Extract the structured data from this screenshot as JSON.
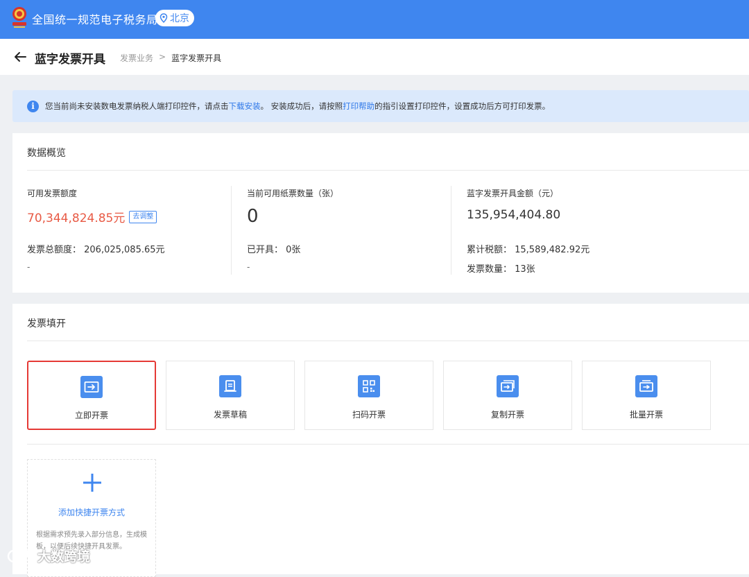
{
  "header": {
    "site_title": "全国统一规范电子税务局",
    "location": "北京"
  },
  "titlebar": {
    "title": "蓝字发票开具",
    "breadcrumb": [
      "发票业务",
      "蓝字发票开具"
    ]
  },
  "notice": {
    "text_1": "您当前尚未安装数电发票纳税人端打印控件，请点击",
    "link_1": "下载安装",
    "text_2": "。 安装成功后，请按照",
    "link_2": "打印帮助",
    "text_3": "的指引设置打印控件，设置成功后方可打印发票。"
  },
  "overview": {
    "title": "数据概览",
    "col1": {
      "label": "可用发票额度",
      "value": "70,344,824.85元",
      "adjust_label": "去调整",
      "total": "发票总额度：  206,025,085.65元",
      "dash": "-"
    },
    "col2": {
      "label": "当前可用纸票数量（张）",
      "value": "0",
      "issued": "已开具：  0张",
      "dash": "-"
    },
    "col3": {
      "label": "蓝字发票开具金额（元）",
      "value": "135,954,404.80",
      "tax": "累计税额：  15,589,482.92元",
      "count": "发票数量：  13张"
    }
  },
  "issue": {
    "title": "发票填开",
    "tiles": [
      {
        "label": "立即开票",
        "icon": "invoice-now-icon"
      },
      {
        "label": "发票草稿",
        "icon": "draft-icon"
      },
      {
        "label": "扫码开票",
        "icon": "qr-code-icon"
      },
      {
        "label": "复制开票",
        "icon": "copy-invoice-icon"
      },
      {
        "label": "批量开票",
        "icon": "batch-invoice-icon"
      }
    ],
    "add_label": "添加快捷开票方式",
    "add_desc": "根据需求预先录入部分信息，生成模板，以便后续快捷开具发票。"
  },
  "watermark": "大数跨境",
  "colors": {
    "primary": "#3f86ef",
    "highlight": "#e53935",
    "amount_red": "#e85a45",
    "notice_bg": "#dbe9fc"
  }
}
